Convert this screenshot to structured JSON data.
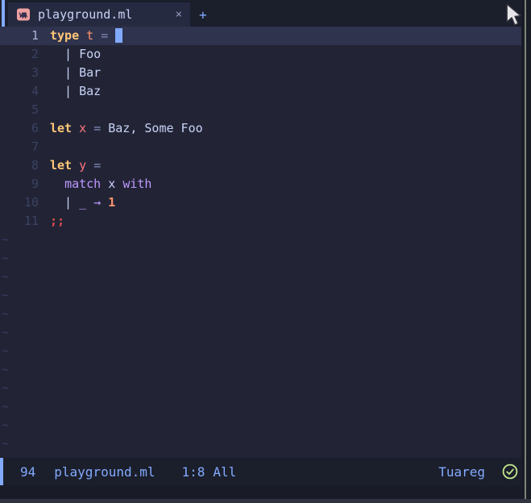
{
  "tab_bar": {
    "active_tab": {
      "icon": "ocaml-camel-icon",
      "label": "playground.ml",
      "close_label": "×"
    },
    "new_tab_label": "+"
  },
  "editor": {
    "lines": [
      {
        "num": "1",
        "current": true,
        "tokens": [
          {
            "t": "type",
            "c": "kw"
          },
          {
            "t": " ",
            "c": "fg"
          },
          {
            "t": "t",
            "c": "type"
          },
          {
            "t": " ",
            "c": "fg"
          },
          {
            "t": "=",
            "c": "op"
          },
          {
            "t": " ",
            "c": "fg"
          },
          {
            "t": " ",
            "c": "cursor"
          }
        ]
      },
      {
        "num": "2",
        "current": false,
        "tokens": [
          {
            "t": "  | Foo",
            "c": "fg"
          }
        ]
      },
      {
        "num": "3",
        "current": false,
        "tokens": [
          {
            "t": "  | Bar",
            "c": "fg"
          }
        ]
      },
      {
        "num": "4",
        "current": false,
        "tokens": [
          {
            "t": "  | Baz",
            "c": "fg"
          }
        ]
      },
      {
        "num": "5",
        "current": false,
        "tokens": []
      },
      {
        "num": "6",
        "current": false,
        "tokens": [
          {
            "t": "let",
            "c": "kw"
          },
          {
            "t": " ",
            "c": "fg"
          },
          {
            "t": "x",
            "c": "var"
          },
          {
            "t": " ",
            "c": "fg"
          },
          {
            "t": "=",
            "c": "op"
          },
          {
            "t": " Baz, Some Foo",
            "c": "fg"
          }
        ]
      },
      {
        "num": "7",
        "current": false,
        "tokens": []
      },
      {
        "num": "8",
        "current": false,
        "tokens": [
          {
            "t": "let",
            "c": "kw"
          },
          {
            "t": " ",
            "c": "fg"
          },
          {
            "t": "y",
            "c": "var"
          },
          {
            "t": " ",
            "c": "fg"
          },
          {
            "t": "=",
            "c": "op"
          }
        ]
      },
      {
        "num": "9",
        "current": false,
        "tokens": [
          {
            "t": "  ",
            "c": "fg"
          },
          {
            "t": "match",
            "c": "kw2"
          },
          {
            "t": " x ",
            "c": "fg"
          },
          {
            "t": "with",
            "c": "kw2"
          }
        ]
      },
      {
        "num": "10",
        "current": false,
        "tokens": [
          {
            "t": "  | ",
            "c": "fg"
          },
          {
            "t": "_",
            "c": "kw2"
          },
          {
            "t": " ",
            "c": "fg"
          },
          {
            "t": "→",
            "c": "kw2"
          },
          {
            "t": " ",
            "c": "fg"
          },
          {
            "t": "1",
            "c": "num"
          }
        ]
      },
      {
        "num": "11",
        "current": false,
        "tokens": [
          {
            "t": ";;",
            "c": "err"
          }
        ]
      }
    ],
    "empty_lines": {
      "marker": "~",
      "count": 12
    }
  },
  "status_bar": {
    "buffer_number": "94",
    "file_name": "playground.ml",
    "cursor_position": "1:8",
    "scroll_position": "All",
    "mode_name": "Tuareg",
    "check_icon": "check-circle-icon"
  },
  "colors": {
    "editor_bg": "#222436",
    "bar_bg": "#1b1e2b",
    "current_line_bg": "#2f334d",
    "accent_blue": "#82aaff",
    "status_text": "#82aaff",
    "check_green": "#c3e88d",
    "keyword_yellow": "#ffc777",
    "orange": "#ff966c",
    "red_pink": "#ff757f",
    "purple": "#c099ff",
    "error_red": "#db4b4b",
    "foreground": "#c8d3f5",
    "line_number": "#3b4261",
    "icon_salmon": "#efa1a1"
  }
}
